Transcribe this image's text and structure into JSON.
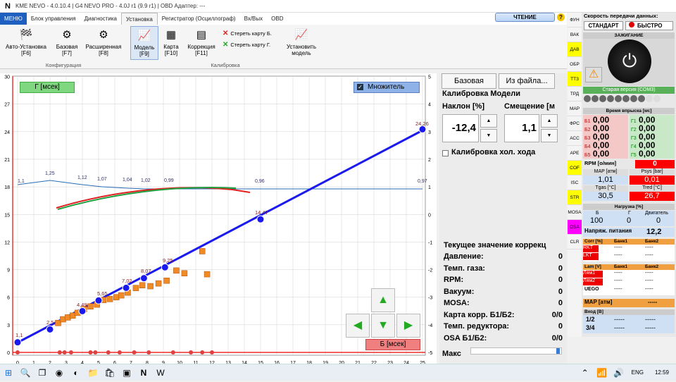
{
  "window": {
    "title": "KME NEVO - 4.0.10.4  |  G4 NEVO PRO - 4.0J r1 (9.9 r1)  |  OBD Адаптер: ---"
  },
  "menu": {
    "items": [
      "МЕНЮ",
      "Блок управления",
      "Диагностика",
      "Установка",
      "Регистратор (Осциллограф)",
      "Вх/Вых",
      "OBD"
    ],
    "read_button": "ЧТЕНИЕ"
  },
  "ribbon": {
    "auto": {
      "label": "Авто-Установка",
      "key": "[F6]"
    },
    "base": {
      "label": "Базовая",
      "key": "[F7]"
    },
    "ext": {
      "label": "Расширенная",
      "key": "[F8]"
    },
    "group1": "Конфигурация",
    "model": {
      "label": "Модель",
      "key": "[F9]"
    },
    "map": {
      "label": "Карта",
      "key": "[F10]"
    },
    "corr": {
      "label": "Коррекция",
      "key": "[F11]"
    },
    "clear_b": "Стереть карту Б.",
    "clear_g": "Стереть карту Г.",
    "set_model": {
      "label": "Установить",
      "label2": "модель"
    },
    "group2": "Калибровка"
  },
  "chart": {
    "g_label": "Г [мсек]",
    "b_label": "Б [мсек]",
    "multiplier": "Множитель",
    "y_left": [
      "30",
      "27",
      "24",
      "21",
      "18",
      "15",
      "12",
      "9",
      "6",
      "3",
      "0"
    ],
    "y_right": [
      "5",
      "4",
      "3",
      "2",
      "1",
      "0",
      "-1",
      "-2",
      "-3",
      "-4",
      "-5"
    ],
    "x_ticks": [
      "0",
      "1",
      "2",
      "3",
      "4",
      "5",
      "6",
      "7",
      "8",
      "9",
      "10",
      "11",
      "12",
      "13",
      "14",
      "15",
      "16",
      "17",
      "18",
      "19",
      "20",
      "21",
      "22",
      "23",
      "24",
      "25"
    ],
    "line_labels": [
      "1,1",
      "2,5",
      "4,49",
      "5,65",
      "7,02",
      "8,07",
      "9,25",
      "14,47",
      "24,26"
    ],
    "mult_labels": [
      "1,1",
      "1,25",
      "1,12",
      "1,07",
      "1,04",
      "1,02",
      "0,99",
      "0,96",
      "0,97"
    ]
  },
  "right": {
    "base_btn": "Базовая",
    "file_btn": "Из файла...",
    "calib_title": "Калибровка Модели",
    "slope_lbl": "Наклон [%]",
    "offset_lbl": "Смещение [м",
    "slope_val": "-12,4",
    "offset_val": "1,1",
    "idle_lbl": "Калибровка хол. хода",
    "corr_title": "Текущее значение коррекц",
    "rows": [
      {
        "k": "Давление:",
        "v": "0"
      },
      {
        "k": "Темп. газа:",
        "v": "0"
      },
      {
        "k": "RPM:",
        "v": "0"
      },
      {
        "k": "Вакуум:",
        "v": "0"
      },
      {
        "k": "MOSA:",
        "v": "0"
      },
      {
        "k": "Карта корр. Б1/Б2:",
        "v": "0/0"
      },
      {
        "k": "Темп. редуктора:",
        "v": "0"
      },
      {
        "k": "OSA Б1/Б2:",
        "v": "0/0"
      }
    ],
    "max_lbl": "Макс"
  },
  "side": {
    "items": [
      "ФУН",
      "ВАК",
      "ДАВ",
      "ОБР",
      "ТТЗ",
      "ТРД",
      "МАР",
      "ФРС",
      "АСС",
      "АРЕ",
      "COF",
      "ISC",
      "STR",
      "MOSA",
      "OSA",
      "CLR"
    ]
  },
  "status": {
    "speed_title": "Скорость передачи данных:",
    "std": "СТАНДАРТ",
    "fast": "БЫСТРО",
    "ign": "ЗАЖИГАНИЕ",
    "old": "Старая версия (COM3)",
    "inj_title": "Время впрыска [мс]",
    "b_inj": [
      [
        "Б1",
        "0,00"
      ],
      [
        "Б2",
        "0,00"
      ],
      [
        "Б3",
        "0,00"
      ],
      [
        "Б4",
        "0,00"
      ],
      [
        "Б5",
        "0,00"
      ]
    ],
    "g_inj": [
      [
        "Г1",
        "0,00"
      ],
      [
        "Г2",
        "0,00"
      ],
      [
        "Г3",
        "0,00"
      ],
      [
        "Г4",
        "0,00"
      ],
      [
        "Г5",
        "0,00"
      ]
    ],
    "rpm_lbl": "RPM [о/мин]",
    "rpm_val": "0",
    "map_lbl": "MAP [атм]",
    "map_val": "1,01",
    "psys_lbl": "Psys [bar]",
    "psys_val": "0,01",
    "tgas_lbl": "Tgas [°C]",
    "tgas_val": "30,5",
    "tred_lbl": "Tred [°C]",
    "tred_val": "26,7",
    "load_lbl": "Нагрузка [%]",
    "load_b": "Б",
    "load_g": "Г",
    "load_e": "Двигатель",
    "load_vals": [
      "100",
      "0",
      "0"
    ],
    "volt_lbl": "Напряж. питания",
    "volt_val": "12,2",
    "corr_lbl": "Corr [%]",
    "bank1": "Банк1",
    "bank2": "Банк2",
    "rkt": "RKT",
    "lkt": "LKT",
    "dash": "-----",
    "lam_lbl": "Lam [V]",
    "lam1": "Лям1",
    "lam2": "Лям2",
    "uego": "UEGO",
    "map2_lbl": "MAP [атм]",
    "input_lbl": "Вход [В]",
    "in12": "1/2",
    "in34": "3/4"
  },
  "taskbar": {
    "lang": "ENG",
    "time": "12:59"
  }
}
